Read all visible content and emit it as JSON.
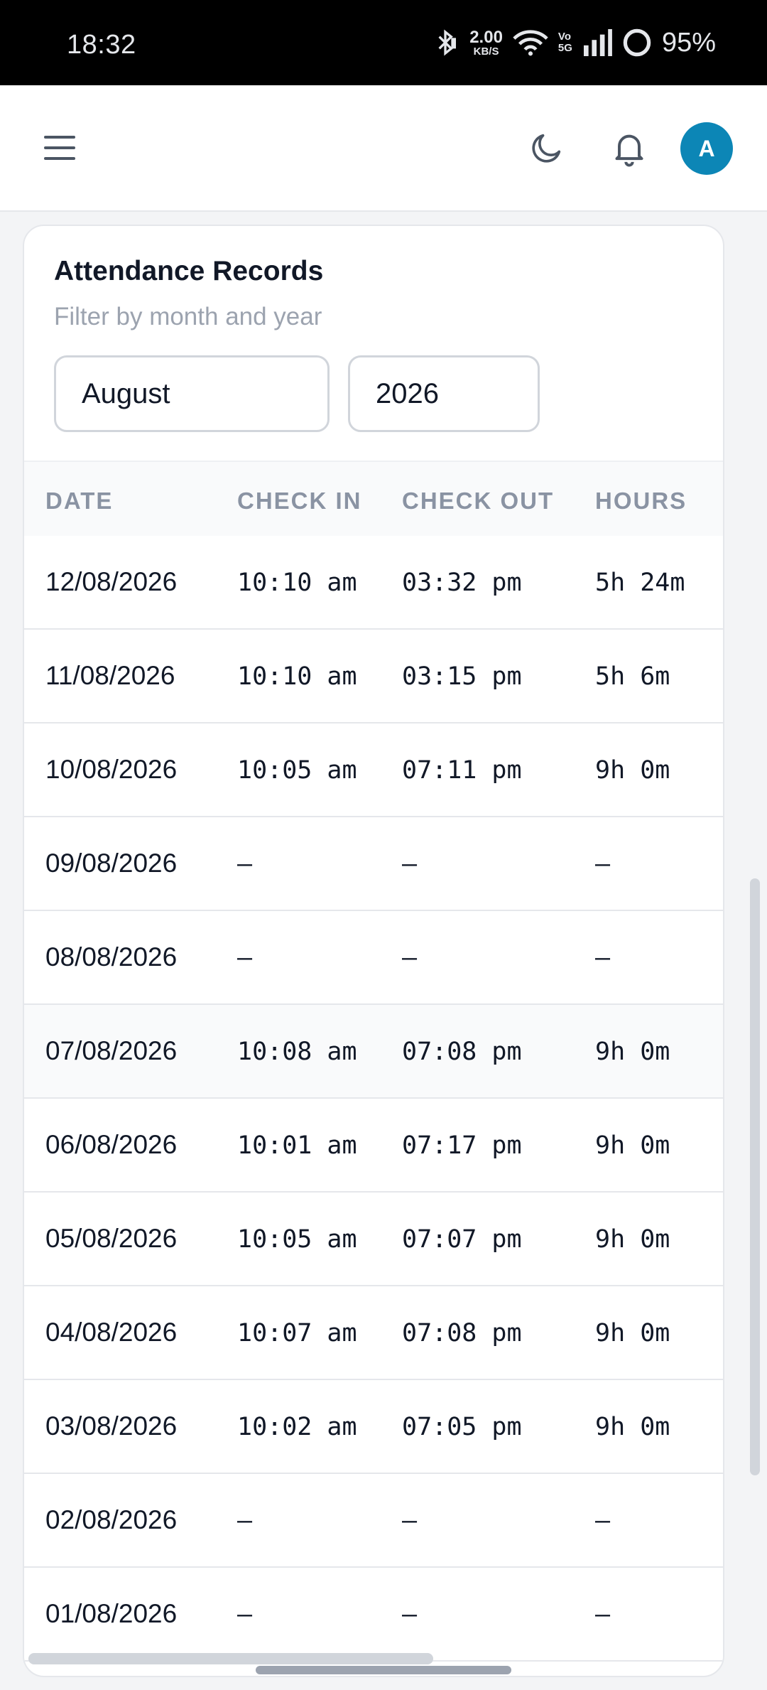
{
  "status_bar": {
    "time": "18:32",
    "net_speed": "2.00",
    "net_unit": "KB/S",
    "volte_top": "Vo",
    "volte_bottom": "5G",
    "battery": "95%",
    "icons": [
      "bluetooth-icon",
      "wifi-icon",
      "signal-icon",
      "battery-ring-icon"
    ]
  },
  "header": {
    "menu_icon": "hamburger-icon",
    "theme_icon": "moon-icon",
    "notification_icon": "bell-icon",
    "avatar_letter": "A",
    "avatar_color": "#0c86b6"
  },
  "card": {
    "title": "Attendance Records",
    "subtitle": "Filter by month and year",
    "month": "August",
    "year": "2026"
  },
  "table": {
    "headers": [
      "DATE",
      "CHECK IN",
      "CHECK OUT",
      "HOURS"
    ],
    "rows": [
      {
        "date": "12/08/2026",
        "in": "10:10 am",
        "out": "03:32 pm",
        "hours": "5h 24m"
      },
      {
        "date": "11/08/2026",
        "in": "10:10 am",
        "out": "03:15 pm",
        "hours": "5h 6m"
      },
      {
        "date": "10/08/2026",
        "in": "10:05 am",
        "out": "07:11 pm",
        "hours": "9h 0m"
      },
      {
        "date": "09/08/2026",
        "in": "—",
        "out": "—",
        "hours": "—"
      },
      {
        "date": "08/08/2026",
        "in": "—",
        "out": "—",
        "hours": "—"
      },
      {
        "date": "07/08/2026",
        "in": "10:08 am",
        "out": "07:08 pm",
        "hours": "9h 0m"
      },
      {
        "date": "06/08/2026",
        "in": "10:01 am",
        "out": "07:17 pm",
        "hours": "9h 0m"
      },
      {
        "date": "05/08/2026",
        "in": "10:05 am",
        "out": "07:07 pm",
        "hours": "9h 0m"
      },
      {
        "date": "04/08/2026",
        "in": "10:07 am",
        "out": "07:08 pm",
        "hours": "9h 0m"
      },
      {
        "date": "03/08/2026",
        "in": "10:02 am",
        "out": "07:05 pm",
        "hours": "9h 0m"
      },
      {
        "date": "02/08/2026",
        "in": "—",
        "out": "—",
        "hours": "—"
      },
      {
        "date": "01/08/2026",
        "in": "—",
        "out": "—",
        "hours": "—"
      }
    ]
  }
}
